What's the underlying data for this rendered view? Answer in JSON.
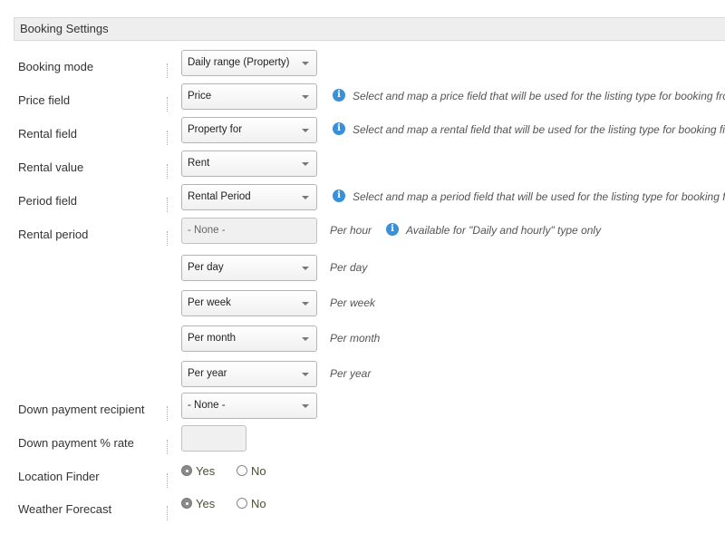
{
  "section": {
    "title": "Booking Settings"
  },
  "rows": {
    "booking_mode": {
      "label": "Booking mode",
      "value": "Daily range (Property)"
    },
    "price_field": {
      "label": "Price field",
      "value": "Price",
      "hint": "Select and map a price field that will be used for the listing type for booking fro"
    },
    "rental_field": {
      "label": "Rental field",
      "value": "Property for",
      "hint": "Select and map a rental field that will be used for the listing type for booking fi"
    },
    "rental_value": {
      "label": "Rental value",
      "value": "Rent"
    },
    "period_field": {
      "label": "Period field",
      "value": "Rental Period",
      "hint": "Select and map a period field that will be used for the listing type for booking f"
    },
    "rental_period": {
      "label": "Rental period",
      "hourly": {
        "value": "- None -",
        "per_label": "Per hour",
        "hint": "Available for \"Daily and hourly\" type only"
      },
      "daily": {
        "value": "Per day",
        "per_label": "Per day"
      },
      "weekly": {
        "value": "Per week",
        "per_label": "Per week"
      },
      "monthly": {
        "value": "Per month",
        "per_label": "Per month"
      },
      "yearly": {
        "value": "Per year",
        "per_label": "Per year"
      }
    },
    "down_payment_recipient": {
      "label": "Down payment recipient",
      "value": "- None -"
    },
    "down_payment_rate": {
      "label": "Down payment % rate",
      "value": ""
    },
    "location_finder": {
      "label": "Location Finder",
      "yes": "Yes",
      "no": "No",
      "selected": "Yes"
    },
    "weather_forecast": {
      "label": "Weather Forecast",
      "yes": "Yes",
      "no": "No",
      "selected": "Yes"
    }
  },
  "colors": {
    "info_icon": "#3a8fd9",
    "header_bg": "#eeeeee"
  },
  "icons": {
    "info": "info-icon",
    "dropdown": "chevron-down-icon"
  }
}
